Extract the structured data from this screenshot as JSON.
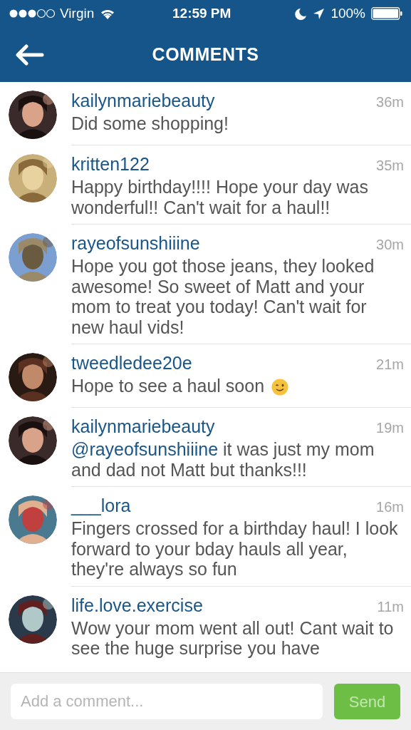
{
  "status_bar": {
    "carrier": "Virgin",
    "time": "12:59 PM",
    "battery": "100%"
  },
  "nav": {
    "title": "COMMENTS"
  },
  "comments": [
    {
      "user": "kailynmariebeauty",
      "time": "36m",
      "text": "Did some shopping!"
    },
    {
      "user": "kritten122",
      "time": "35m",
      "text": "Happy birthday!!!! Hope your day was wonderful!! Can't wait for a haul!!"
    },
    {
      "user": "rayeofsunshiiine",
      "time": "30m",
      "text": "Hope you got those jeans, they looked awesome! So sweet of Matt and your mom to treat you today! Can't wait for new haul vids!"
    },
    {
      "user": "tweedledee20e",
      "time": "21m",
      "text": "Hope to see a haul soon",
      "emoji": true
    },
    {
      "user": "kailynmariebeauty",
      "time": "19m",
      "mention": "@rayeofsunshiiine",
      "text": " it was just my mom and dad not Matt but thanks!!!"
    },
    {
      "user": "___lora",
      "time": "16m",
      "text": "Fingers crossed for a birthday haul! I look forward to your bday hauls all year, they're always so fun"
    },
    {
      "user": "life.love.exercise",
      "time": "11m",
      "text": "Wow your mom went all out! Cant wait to see the huge surprise you have"
    }
  ],
  "composer": {
    "placeholder": "Add a comment...",
    "send": {
      "label": "Send",
      "disabled": true
    }
  }
}
